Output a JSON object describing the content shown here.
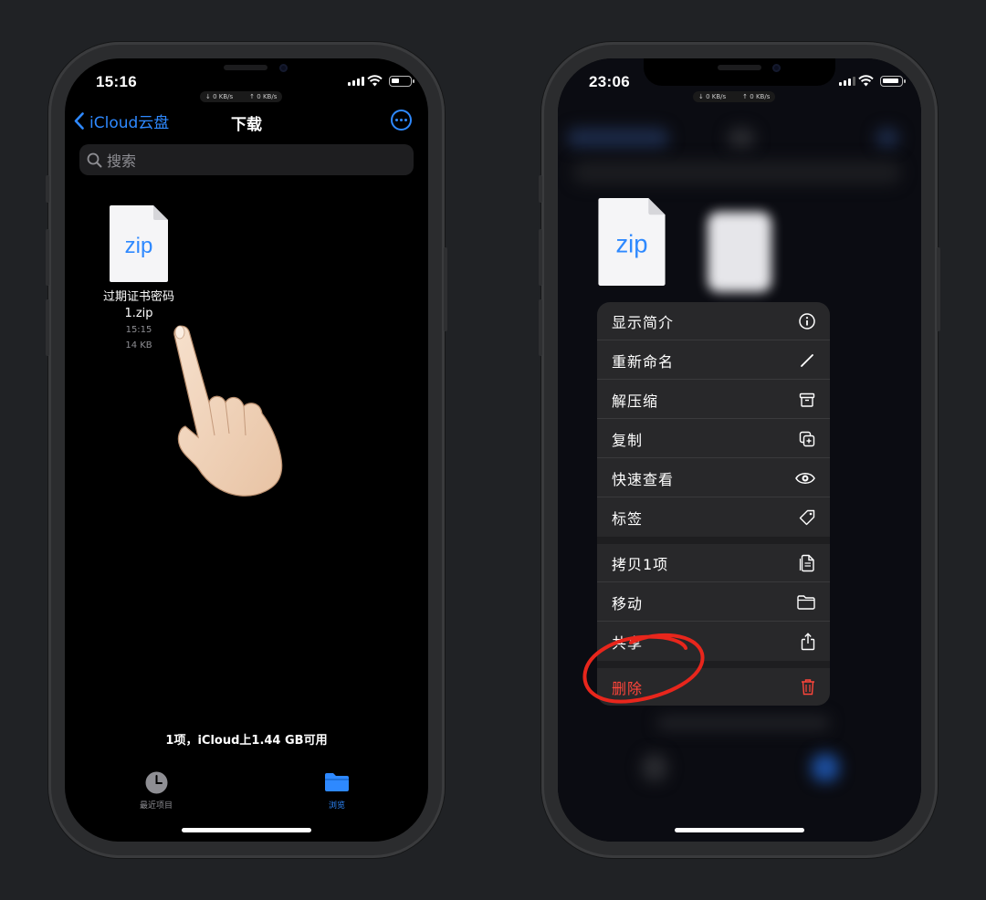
{
  "left_phone": {
    "status": {
      "time": "15:16",
      "down_speed": "↓ 0 KB/s",
      "up_speed": "↑ 0 KB/s"
    },
    "nav": {
      "back_label": "iCloud云盘",
      "title": "下载"
    },
    "search": {
      "placeholder": "搜索"
    },
    "file": {
      "badge": "zip",
      "name_line1": "过期证书密码",
      "name_line2": "1.zip",
      "time": "15:15",
      "size": "14 KB"
    },
    "footer_text": "1项，iCloud上1.44 GB可用",
    "tabs": [
      {
        "label": "最近项目",
        "icon": "clock-icon",
        "color": "#8e8e93"
      },
      {
        "label": "浏览",
        "icon": "folder-icon",
        "color": "#2e89ff"
      }
    ]
  },
  "right_phone": {
    "status": {
      "time": "23:06",
      "down_speed": "↓ 0 KB/s",
      "up_speed": "↑ 0 KB/s"
    },
    "file": {
      "badge": "zip"
    },
    "context_menu": [
      {
        "label": "显示简介",
        "icon": "info-icon"
      },
      {
        "label": "重新命名",
        "icon": "pencil-icon"
      },
      {
        "label": "解压缩",
        "icon": "archive-box-icon"
      },
      {
        "label": "复制",
        "icon": "duplicate-icon"
      },
      {
        "label": "快速查看",
        "icon": "eye-icon"
      },
      {
        "label": "标签",
        "icon": "tag-icon"
      },
      {
        "label": "拷贝1项",
        "icon": "copy-doc-icon"
      },
      {
        "label": "移动",
        "icon": "folder-icon"
      },
      {
        "label": "共享",
        "icon": "share-icon"
      },
      {
        "label": "删除",
        "icon": "trash-icon",
        "color": "#ff453a"
      }
    ]
  },
  "colors": {
    "accent": "#2e89ff",
    "destructive": "#ff453a",
    "annotation": "#e8261c"
  }
}
